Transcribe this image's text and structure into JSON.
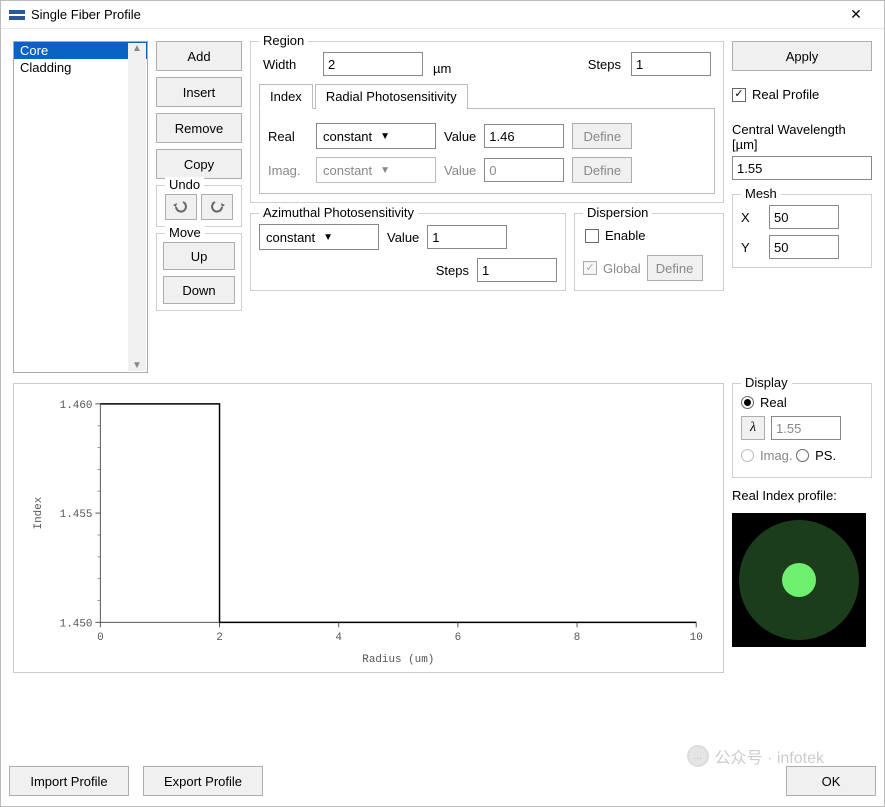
{
  "window": {
    "title": "Single Fiber Profile",
    "close": "✕"
  },
  "list": {
    "items": [
      "Core",
      "Cladding"
    ],
    "selectedIndex": 0
  },
  "buttons": {
    "add": "Add",
    "insert": "Insert",
    "remove": "Remove",
    "copy": "Copy",
    "undo_group": "Undo",
    "move_group": "Move",
    "up": "Up",
    "down": "Down",
    "apply": "Apply",
    "import": "Import Profile",
    "export": "Export Profile",
    "ok": "OK",
    "define": "Define"
  },
  "region": {
    "title": "Region",
    "width_label": "Width",
    "width_value": "2",
    "width_unit": "µm",
    "steps_label": "Steps",
    "steps_value": "1",
    "tabs": {
      "index": "Index",
      "radial": "Radial Photosensitivity"
    },
    "real_label": "Real",
    "real_combo": "constant",
    "real_value_label": "Value",
    "real_value": "1.46",
    "imag_label": "Imag.",
    "imag_combo": "constant",
    "imag_value_label": "Value",
    "imag_value": "0"
  },
  "azimuthal": {
    "title": "Azimuthal Photosensitivity",
    "combo": "constant",
    "value_label": "Value",
    "value": "1",
    "steps_label": "Steps",
    "steps_value": "1"
  },
  "dispersion": {
    "title": "Dispersion",
    "enable_label": "Enable",
    "enable": false,
    "global_label": "Global",
    "global": true
  },
  "real_profile": {
    "label": "Real Profile",
    "checked": true
  },
  "central_wl": {
    "label": "Central Wavelength [µm]",
    "value": "1.55"
  },
  "mesh": {
    "title": "Mesh",
    "x_label": "X",
    "x": "50",
    "y_label": "Y",
    "y": "50"
  },
  "display": {
    "title": "Display",
    "real_label": "Real",
    "real": true,
    "lambda": "λ",
    "lambda_value": "1.55",
    "imag_label": "Imag.",
    "imag": false,
    "ps_label": "PS.",
    "ps": false
  },
  "profile_preview_label": "Real Index profile:",
  "watermark_text": "公众号 · infotek",
  "chart_data": {
    "type": "line",
    "xlabel": "Radius (um)",
    "ylabel": "Index",
    "xlim": [
      0,
      10
    ],
    "ylim": [
      1.45,
      1.46
    ],
    "xticks": [
      0,
      2,
      4,
      6,
      8,
      10
    ],
    "yticks": [
      1.45,
      1.455,
      1.46
    ],
    "series": [
      {
        "name": "index",
        "x": [
          0,
          2,
          2,
          10
        ],
        "y": [
          1.46,
          1.46,
          1.45,
          1.45
        ]
      }
    ]
  }
}
